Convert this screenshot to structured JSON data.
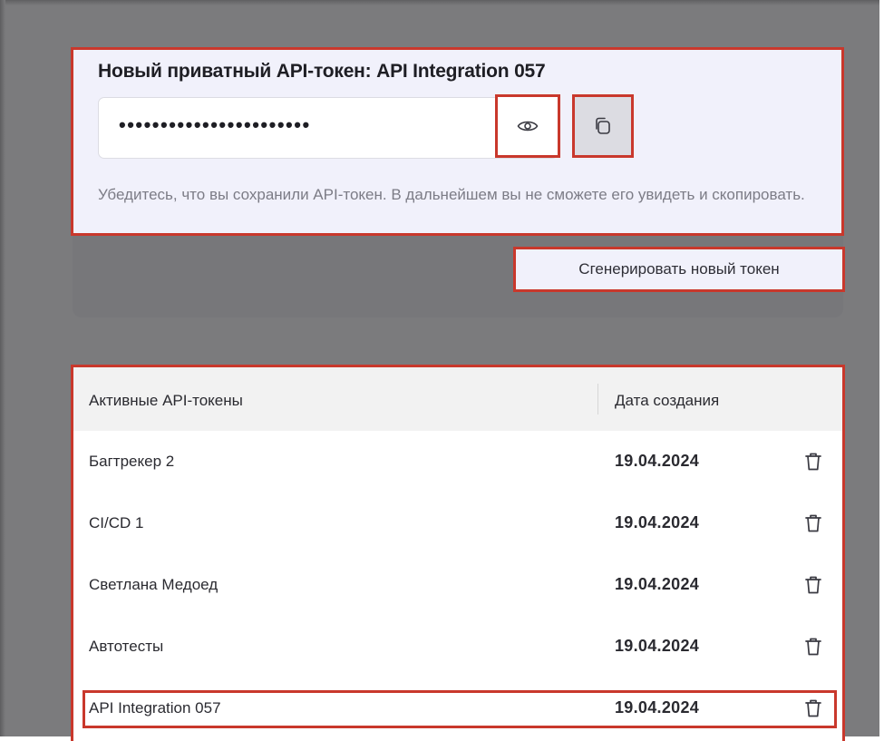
{
  "new_token": {
    "title": "Новый приватный API-токен: API Integration 057",
    "masked_value": "•••••••••••••••••••••••",
    "warning": "Убедитесь, что вы сохранили API-токен. В дальнейшем вы не сможете его увидеть и скопировать.",
    "show_icon": "eye-icon",
    "copy_icon": "copy-icon"
  },
  "generate_button_label": "Сгенерировать новый токен",
  "table": {
    "columns": [
      "Активные API-токены",
      "Дата создания"
    ],
    "rows": [
      {
        "name": "Багтрекер 2",
        "date": "19.04.2024"
      },
      {
        "name": "CI/CD 1",
        "date": "19.04.2024"
      },
      {
        "name": "Светлана Медоед",
        "date": "19.04.2024"
      },
      {
        "name": "Автотесты",
        "date": "19.04.2024"
      },
      {
        "name": "API Integration 057",
        "date": "19.04.2024"
      }
    ],
    "delete_icon": "trash-icon"
  },
  "colors": {
    "overlay": "#7b7b7d",
    "highlight": "#c9382c",
    "panel": "#f1f1fb"
  }
}
